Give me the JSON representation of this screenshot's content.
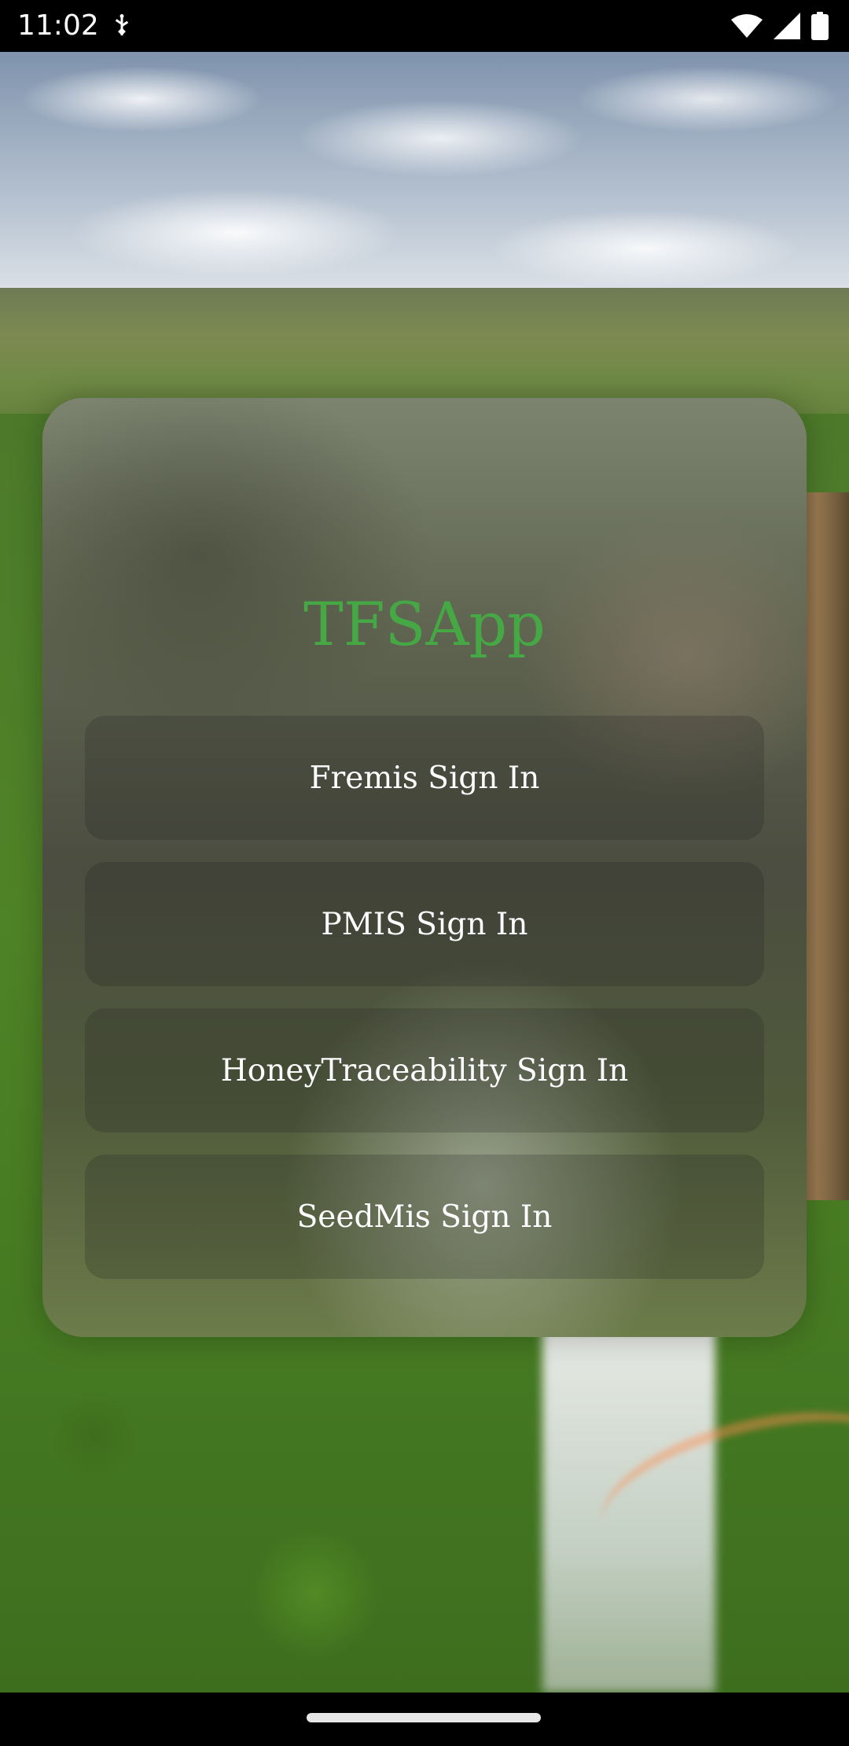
{
  "status_bar": {
    "time": "11:02",
    "icons": [
      "usb-icon",
      "wifi-icon",
      "cellular-signal-icon",
      "battery-icon"
    ]
  },
  "app": {
    "title": "TFSApp",
    "title_color": "#45a845"
  },
  "buttons": [
    {
      "label": "Fremis Sign In"
    },
    {
      "label": "PMIS Sign In"
    },
    {
      "label": "HoneyTraceability Sign In"
    },
    {
      "label": "SeedMis Sign In"
    }
  ],
  "navigation": {
    "handle": "home-gesture-bar"
  }
}
